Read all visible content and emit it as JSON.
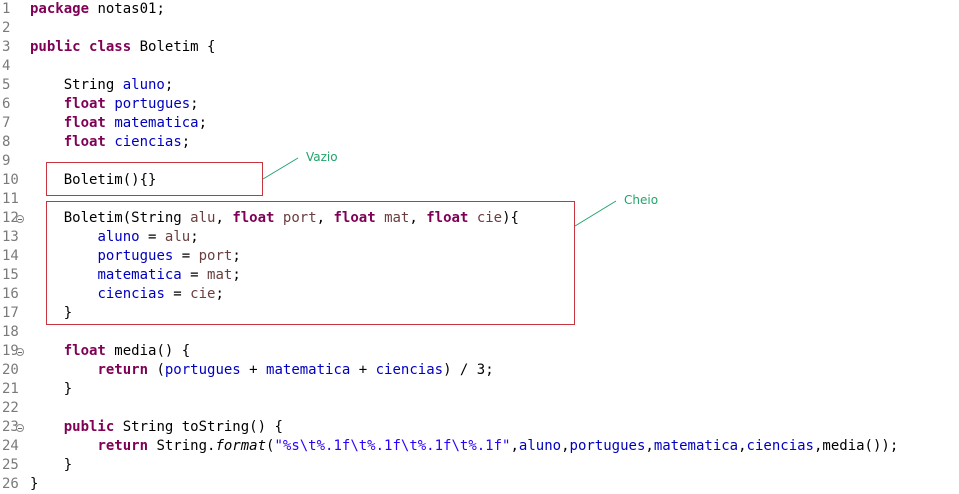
{
  "editor": {
    "colors": {
      "keyword": "#7f0055",
      "field": "#0000c0",
      "param": "#6a3e3e",
      "string": "#2a00ff",
      "line_number": "#7a7a7a",
      "annotation_box": "#c8343f",
      "annotation_text": "#22a36b"
    },
    "lines": [
      {
        "n": "1",
        "fold": false,
        "tokens": [
          {
            "t": "package",
            "c": "keyword"
          },
          {
            "t": " notas01;",
            "c": "plain"
          }
        ]
      },
      {
        "n": "2",
        "fold": false,
        "tokens": []
      },
      {
        "n": "3",
        "fold": false,
        "tokens": [
          {
            "t": "public",
            "c": "keyword"
          },
          {
            "t": " ",
            "c": "plain"
          },
          {
            "t": "class",
            "c": "keyword"
          },
          {
            "t": " Boletim {",
            "c": "plain"
          }
        ]
      },
      {
        "n": "4",
        "fold": false,
        "tokens": []
      },
      {
        "n": "5",
        "fold": false,
        "tokens": [
          {
            "t": "    String ",
            "c": "plain"
          },
          {
            "t": "aluno",
            "c": "field"
          },
          {
            "t": ";",
            "c": "plain"
          }
        ]
      },
      {
        "n": "6",
        "fold": false,
        "tokens": [
          {
            "t": "    ",
            "c": "plain"
          },
          {
            "t": "float",
            "c": "keyword"
          },
          {
            "t": " ",
            "c": "plain"
          },
          {
            "t": "portugues",
            "c": "field"
          },
          {
            "t": ";",
            "c": "plain"
          }
        ]
      },
      {
        "n": "7",
        "fold": false,
        "tokens": [
          {
            "t": "    ",
            "c": "plain"
          },
          {
            "t": "float",
            "c": "keyword"
          },
          {
            "t": " ",
            "c": "plain"
          },
          {
            "t": "matematica",
            "c": "field"
          },
          {
            "t": ";",
            "c": "plain"
          }
        ]
      },
      {
        "n": "8",
        "fold": false,
        "tokens": [
          {
            "t": "    ",
            "c": "plain"
          },
          {
            "t": "float",
            "c": "keyword"
          },
          {
            "t": " ",
            "c": "plain"
          },
          {
            "t": "ciencias",
            "c": "field"
          },
          {
            "t": ";",
            "c": "plain"
          }
        ]
      },
      {
        "n": "9",
        "fold": false,
        "tokens": []
      },
      {
        "n": "10",
        "fold": false,
        "tokens": [
          {
            "t": "    Boletim(){}",
            "c": "plain"
          }
        ]
      },
      {
        "n": "11",
        "fold": false,
        "tokens": []
      },
      {
        "n": "12",
        "fold": true,
        "tokens": [
          {
            "t": "    Boletim(String ",
            "c": "plain"
          },
          {
            "t": "alu",
            "c": "param"
          },
          {
            "t": ", ",
            "c": "plain"
          },
          {
            "t": "float",
            "c": "keyword"
          },
          {
            "t": " ",
            "c": "plain"
          },
          {
            "t": "port",
            "c": "param"
          },
          {
            "t": ", ",
            "c": "plain"
          },
          {
            "t": "float",
            "c": "keyword"
          },
          {
            "t": " ",
            "c": "plain"
          },
          {
            "t": "mat",
            "c": "param"
          },
          {
            "t": ", ",
            "c": "plain"
          },
          {
            "t": "float",
            "c": "keyword"
          },
          {
            "t": " ",
            "c": "plain"
          },
          {
            "t": "cie",
            "c": "param"
          },
          {
            "t": "){",
            "c": "plain"
          }
        ]
      },
      {
        "n": "13",
        "fold": false,
        "tokens": [
          {
            "t": "        ",
            "c": "plain"
          },
          {
            "t": "aluno",
            "c": "field"
          },
          {
            "t": " = ",
            "c": "plain"
          },
          {
            "t": "alu",
            "c": "param"
          },
          {
            "t": ";",
            "c": "plain"
          }
        ]
      },
      {
        "n": "14",
        "fold": false,
        "tokens": [
          {
            "t": "        ",
            "c": "plain"
          },
          {
            "t": "portugues",
            "c": "field"
          },
          {
            "t": " = ",
            "c": "plain"
          },
          {
            "t": "port",
            "c": "param"
          },
          {
            "t": ";",
            "c": "plain"
          }
        ]
      },
      {
        "n": "15",
        "fold": false,
        "tokens": [
          {
            "t": "        ",
            "c": "plain"
          },
          {
            "t": "matematica",
            "c": "field"
          },
          {
            "t": " = ",
            "c": "plain"
          },
          {
            "t": "mat",
            "c": "param"
          },
          {
            "t": ";",
            "c": "plain"
          }
        ]
      },
      {
        "n": "16",
        "fold": false,
        "tokens": [
          {
            "t": "        ",
            "c": "plain"
          },
          {
            "t": "ciencias",
            "c": "field"
          },
          {
            "t": " = ",
            "c": "plain"
          },
          {
            "t": "cie",
            "c": "param"
          },
          {
            "t": ";",
            "c": "plain"
          }
        ]
      },
      {
        "n": "17",
        "fold": false,
        "tokens": [
          {
            "t": "    }",
            "c": "plain"
          }
        ]
      },
      {
        "n": "18",
        "fold": false,
        "tokens": []
      },
      {
        "n": "19",
        "fold": true,
        "tokens": [
          {
            "t": "    ",
            "c": "plain"
          },
          {
            "t": "float",
            "c": "keyword"
          },
          {
            "t": " media() {",
            "c": "plain"
          }
        ]
      },
      {
        "n": "20",
        "fold": false,
        "tokens": [
          {
            "t": "        ",
            "c": "plain"
          },
          {
            "t": "return",
            "c": "keyword"
          },
          {
            "t": " (",
            "c": "plain"
          },
          {
            "t": "portugues",
            "c": "field"
          },
          {
            "t": " + ",
            "c": "plain"
          },
          {
            "t": "matematica",
            "c": "field"
          },
          {
            "t": " + ",
            "c": "plain"
          },
          {
            "t": "ciencias",
            "c": "field"
          },
          {
            "t": ") / 3;",
            "c": "plain"
          }
        ]
      },
      {
        "n": "21",
        "fold": false,
        "tokens": [
          {
            "t": "    }",
            "c": "plain"
          }
        ]
      },
      {
        "n": "22",
        "fold": false,
        "tokens": []
      },
      {
        "n": "23",
        "fold": true,
        "tokens": [
          {
            "t": "    ",
            "c": "plain"
          },
          {
            "t": "public",
            "c": "keyword"
          },
          {
            "t": " String toString() {",
            "c": "plain"
          }
        ]
      },
      {
        "n": "24",
        "fold": false,
        "tokens": [
          {
            "t": "        ",
            "c": "plain"
          },
          {
            "t": "return",
            "c": "keyword"
          },
          {
            "t": " String.",
            "c": "plain"
          },
          {
            "t": "format",
            "c": "method-italic"
          },
          {
            "t": "(",
            "c": "plain"
          },
          {
            "t": "\"%s\\t%.1f\\t%.1f\\t%.1f\\t%.1f\"",
            "c": "string"
          },
          {
            "t": ",",
            "c": "plain"
          },
          {
            "t": "aluno",
            "c": "field"
          },
          {
            "t": ",",
            "c": "plain"
          },
          {
            "t": "portugues",
            "c": "field"
          },
          {
            "t": ",",
            "c": "plain"
          },
          {
            "t": "matematica",
            "c": "field"
          },
          {
            "t": ",",
            "c": "plain"
          },
          {
            "t": "ciencias",
            "c": "field"
          },
          {
            "t": ",media());",
            "c": "plain"
          }
        ]
      },
      {
        "n": "25",
        "fold": false,
        "tokens": [
          {
            "t": "    }",
            "c": "plain"
          }
        ]
      },
      {
        "n": "26",
        "fold": false,
        "tokens": [
          {
            "t": "}",
            "c": "plain"
          }
        ]
      }
    ]
  },
  "annotations": {
    "empty_constructor": {
      "label": "Vazio"
    },
    "full_constructor": {
      "label": "Cheio"
    }
  }
}
